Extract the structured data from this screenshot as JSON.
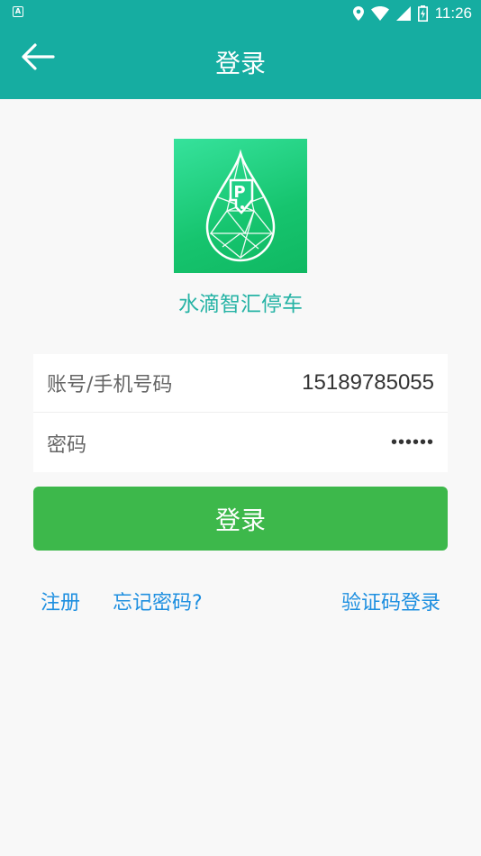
{
  "status_bar": {
    "left_badge": "A",
    "time": "11:26",
    "icons": [
      "location-icon",
      "wifi-icon",
      "signal-icon",
      "battery-icon"
    ]
  },
  "app_bar": {
    "back_icon": "arrow-left-icon",
    "title": "登录"
  },
  "logo": {
    "icon": "water-drop-parking-logo",
    "app_name": "水滴智汇停车"
  },
  "form": {
    "account_label": "账号/手机号码",
    "account_value": "15189785055",
    "password_label": "密码",
    "password_value": "••••••"
  },
  "login_button": "登录",
  "links": {
    "register": "注册",
    "forgot": "忘记密码?",
    "sms_login": "验证码登录"
  },
  "colors": {
    "primary": "#16ada1",
    "button": "#3db84b",
    "link": "#1e8fe0",
    "app_name": "#26b3a5"
  }
}
